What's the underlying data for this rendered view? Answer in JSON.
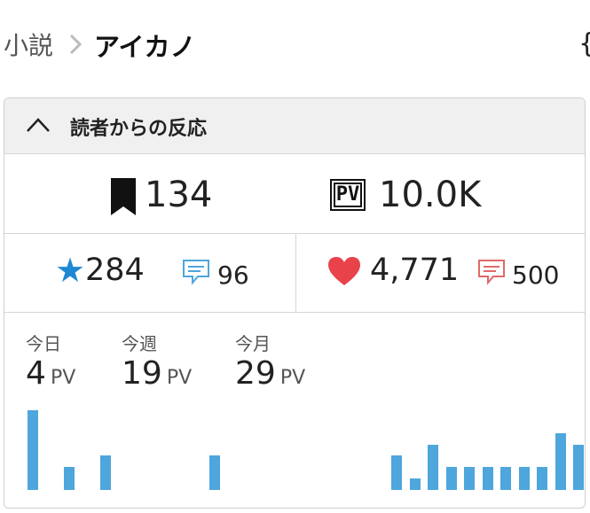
{
  "breadcrumb": {
    "parent": "小説",
    "current": "アイカノ"
  },
  "top_right_icon": "{",
  "panel": {
    "title": "読者からの反応",
    "bookmarks": "134",
    "pv_badge": "PV",
    "pv_total": "10.0K",
    "stars": "284",
    "reviews": "96",
    "hearts": "4,771",
    "comments": "500"
  },
  "periods": [
    {
      "label": "今日",
      "value": "4",
      "unit": "PV"
    },
    {
      "label": "今週",
      "value": "19",
      "unit": "PV"
    },
    {
      "label": "今月",
      "value": "29",
      "unit": "PV"
    }
  ],
  "colors": {
    "accent_blue": "#1f88d3",
    "bar_blue": "#4ea6dc",
    "heart_red": "#e8434b",
    "comment_red": "#e06a6a"
  },
  "chart_data": {
    "type": "bar",
    "title": "",
    "xlabel": "",
    "ylabel": "",
    "grid": false,
    "values": [
      7,
      0,
      2,
      0,
      3,
      0,
      0,
      0,
      0,
      0,
      3,
      0,
      0,
      0,
      0,
      0,
      0,
      0,
      0,
      0,
      3,
      1,
      4,
      2,
      2,
      2,
      2,
      2,
      2,
      5,
      4
    ],
    "ylim": [
      0,
      7
    ]
  }
}
